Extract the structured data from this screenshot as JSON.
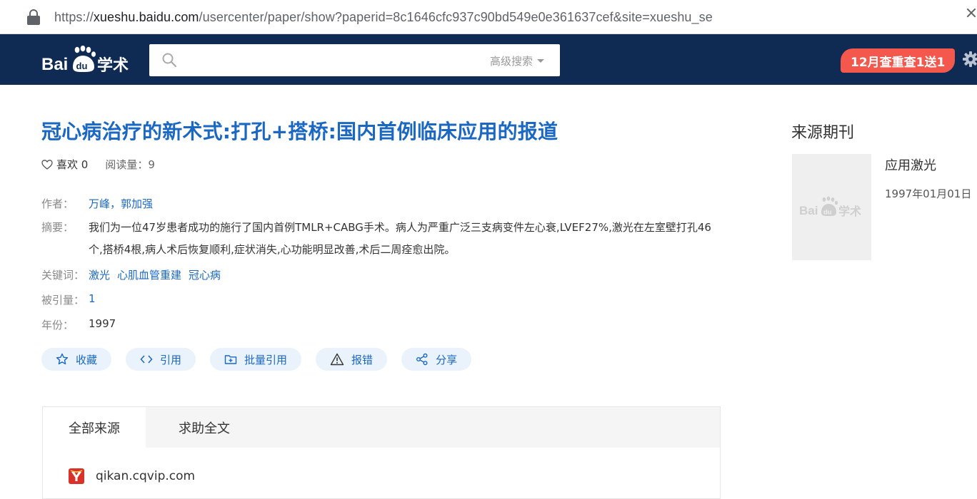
{
  "browser": {
    "url_prefix": "https://",
    "url_host": "xueshu.baidu.com",
    "url_path": "/usercenter/paper/show?paperid=8c1646cfc937c90bd549e0e361637cef&site=xueshu_se"
  },
  "header": {
    "logo_text": "Bai",
    "logo_du": "du",
    "logo_cn": "学术",
    "search_placeholder": "",
    "advanced_search": "高级搜索",
    "promo": "12月查重查1送1"
  },
  "paper": {
    "title": "冠心病治疗的新术式:打孔+搭桥:国内首例临床应用的报道",
    "likes_label": "喜欢",
    "likes": "0",
    "reads_label": "阅读量：",
    "reads": "9",
    "authors_label": "作者：",
    "authors": "万峰，郭加强",
    "abstract_label": "摘要：",
    "abstract": "我们为一位47岁患者成功的施行了国内首例TMLR+CABG手术。病人为严重广泛三支病变件左心衰,LVEF27%,激光在左室壁打孔46个,搭桥4根,病人术后恢复顺利,症状消失,心功能明显改善,术后二周痊愈出院。",
    "keywords_label": "关键词：",
    "keywords": [
      "激光",
      "心肌血管重建",
      "冠心病"
    ],
    "cited_label": "被引量：",
    "cited": "1",
    "year_label": "年份：",
    "year": "1997"
  },
  "actions": [
    {
      "label": "收藏",
      "icon": "star-icon"
    },
    {
      "label": "引用",
      "icon": "code-icon"
    },
    {
      "label": "批量引用",
      "icon": "folder-add-icon"
    },
    {
      "label": "报错",
      "icon": "warning-icon"
    },
    {
      "label": "分享",
      "icon": "share-icon"
    }
  ],
  "tabs": [
    {
      "label": "全部来源"
    },
    {
      "label": "求助全文"
    }
  ],
  "sources": [
    {
      "name": "qikan.cqvip.com",
      "icon": "cqvip-icon"
    }
  ],
  "sidebar": {
    "title": "来源期刊",
    "journal_name": "应用激光",
    "journal_date": "1997年01月01日",
    "cover_text_bai": "Bai",
    "cover_text_du": "du",
    "cover_text_cn": "学术"
  },
  "colors": {
    "header_bg": "#0f2b53",
    "link_blue": "#1b68c2",
    "promo_red": "#f4574b",
    "action_bg": "#eaf2fb"
  }
}
